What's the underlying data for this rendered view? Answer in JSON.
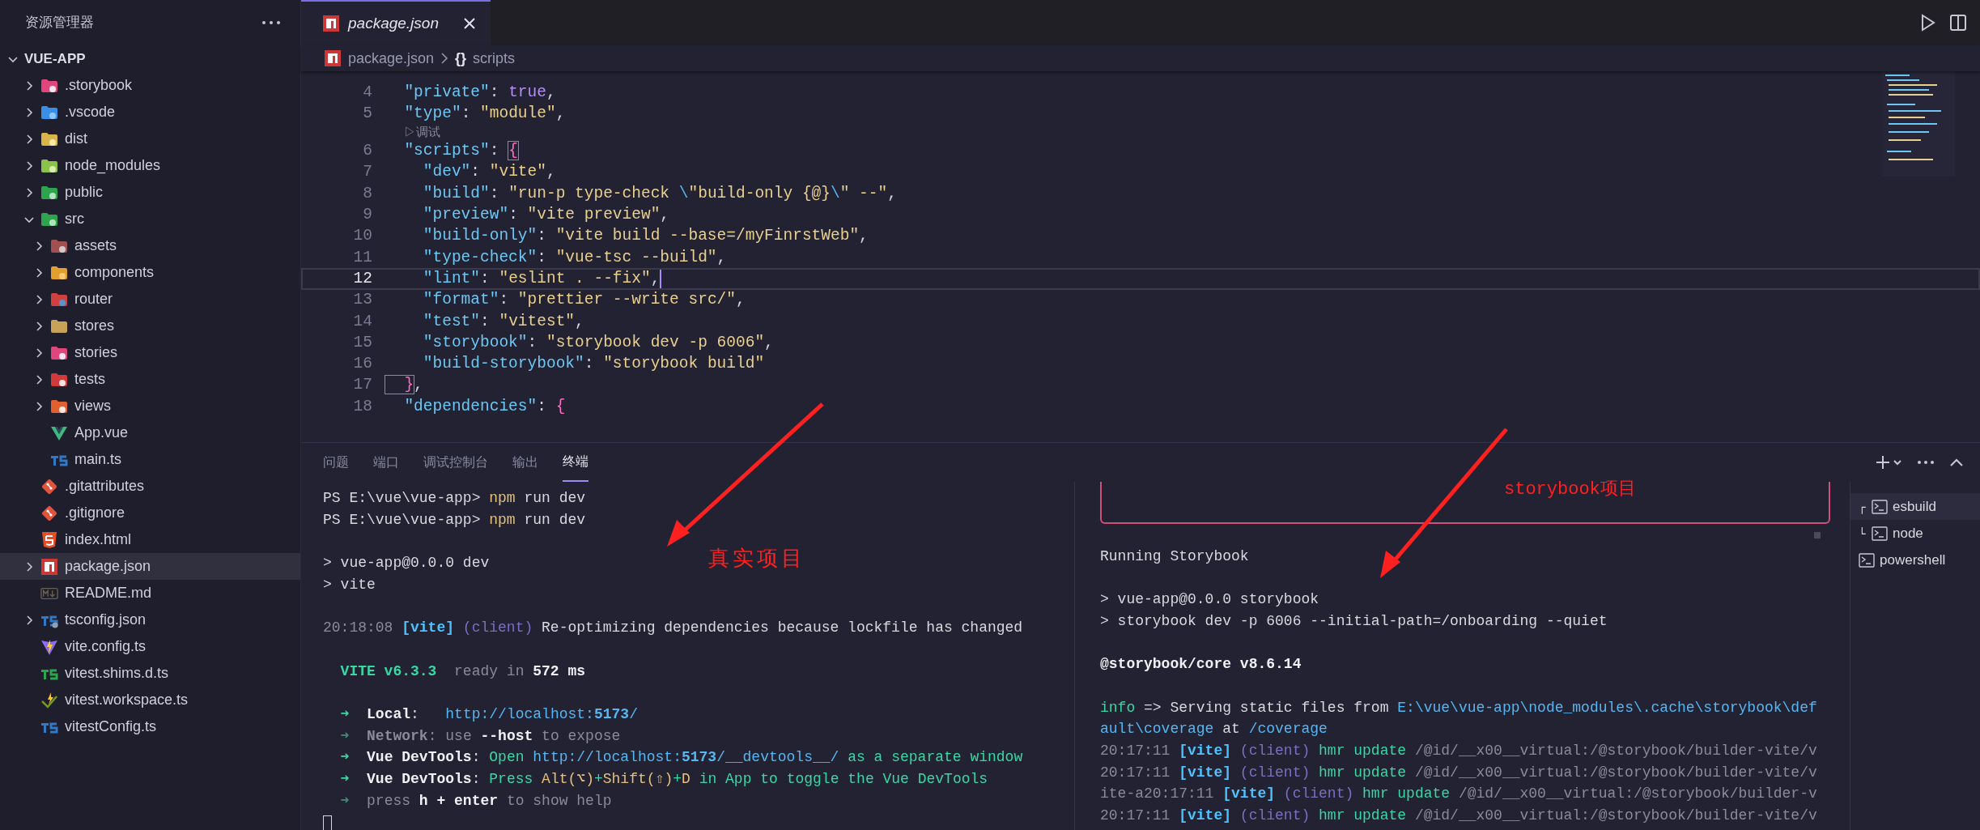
{
  "sidebar": {
    "title": "资源管理器",
    "root": {
      "label": "VUE-APP",
      "expanded": true
    },
    "items": [
      {
        "label": ".storybook",
        "kind": "storybook",
        "expanded": false,
        "selected": false
      },
      {
        "label": ".vscode",
        "kind": "vscode",
        "expanded": false,
        "selected": false
      },
      {
        "label": "dist",
        "kind": "dist",
        "expanded": false,
        "selected": false
      },
      {
        "label": "node_modules",
        "kind": "node",
        "expanded": false,
        "selected": false
      },
      {
        "label": "public",
        "kind": "public",
        "expanded": false,
        "selected": false
      },
      {
        "label": "src",
        "kind": "src",
        "expanded": true,
        "selected": false,
        "children": [
          {
            "label": "assets",
            "kind": "assets",
            "expanded": false,
            "selected": false
          },
          {
            "label": "components",
            "kind": "components",
            "expanded": false,
            "selected": false
          },
          {
            "label": "router",
            "kind": "router",
            "expanded": false,
            "selected": false
          },
          {
            "label": "stores",
            "kind": "stores",
            "expanded": false,
            "selected": false
          },
          {
            "label": "stories",
            "kind": "stories",
            "expanded": false,
            "selected": false
          },
          {
            "label": "tests",
            "kind": "tests",
            "expanded": false,
            "selected": false
          },
          {
            "label": "views",
            "kind": "views",
            "expanded": false,
            "selected": false
          },
          {
            "label": "App.vue",
            "kind": "vue",
            "selected": false
          },
          {
            "label": "main.ts",
            "kind": "ts",
            "selected": false
          }
        ]
      },
      {
        "label": ".gitattributes",
        "kind": "git",
        "selected": false
      },
      {
        "label": ".gitignore",
        "kind": "git",
        "selected": false
      },
      {
        "label": "index.html",
        "kind": "html",
        "selected": false
      },
      {
        "label": "package.json",
        "kind": "npm",
        "expanded": false,
        "selected": true
      },
      {
        "label": "README.md",
        "kind": "md",
        "selected": false
      },
      {
        "label": "tsconfig.json",
        "kind": "tsconfig",
        "expanded": false,
        "selected": false
      },
      {
        "label": "vite.config.ts",
        "kind": "vite",
        "selected": false
      },
      {
        "label": "vitest.shims.d.ts",
        "kind": "tsgreen",
        "selected": false
      },
      {
        "label": "vitest.workspace.ts",
        "kind": "vitest",
        "selected": false
      },
      {
        "label": "vitestConfig.ts",
        "kind": "ts",
        "selected": false
      }
    ]
  },
  "editor": {
    "tabs": [
      {
        "label": "package.json",
        "kind": "npm",
        "preview": true,
        "selected": true
      }
    ],
    "breadcrumb": [
      {
        "label": "package.json",
        "kind": "npm"
      },
      {
        "label": "scripts",
        "symbol": "{}"
      }
    ],
    "lines": [
      {
        "number": "4",
        "current": false,
        "tokens": [
          {
            "text": "  \"private\"",
            "kind": "key"
          },
          {
            "text": ": ",
            "kind": "p"
          },
          {
            "text": "true",
            "kind": "bool"
          },
          {
            "text": ",",
            "kind": "p"
          }
        ]
      },
      {
        "number": "5",
        "current": false,
        "tokens": [
          {
            "text": "  \"type\"",
            "kind": "key"
          },
          {
            "text": ": ",
            "kind": "p"
          },
          {
            "text": "\"module\"",
            "kind": "str"
          },
          {
            "text": ",",
            "kind": "p"
          }
        ]
      },
      {
        "kind": "codelens",
        "text": "▷调试"
      },
      {
        "number": "6",
        "current": false,
        "tokens": [
          {
            "text": "  \"scripts\"",
            "kind": "key"
          },
          {
            "text": ": ",
            "kind": "p"
          },
          {
            "text": "{",
            "kind": "match"
          }
        ]
      },
      {
        "number": "7",
        "current": false,
        "tokens": [
          {
            "text": "    \"dev\"",
            "kind": "key"
          },
          {
            "text": ": ",
            "kind": "p"
          },
          {
            "text": "\"vite\"",
            "kind": "str"
          },
          {
            "text": ",",
            "kind": "p"
          }
        ]
      },
      {
        "number": "8",
        "current": false,
        "tokens": [
          {
            "text": "    \"build\"",
            "kind": "key"
          },
          {
            "text": ": ",
            "kind": "p"
          },
          {
            "text": "\"run-p type-check ",
            "kind": "str"
          },
          {
            "text": "\\",
            "kind": "esc"
          },
          {
            "text": "\"build-only {@}",
            "kind": "str"
          },
          {
            "text": "\\",
            "kind": "esc"
          },
          {
            "text": "\" --\"",
            "kind": "str"
          },
          {
            "text": ",",
            "kind": "p"
          }
        ]
      },
      {
        "number": "9",
        "current": false,
        "tokens": [
          {
            "text": "    \"preview\"",
            "kind": "key"
          },
          {
            "text": ": ",
            "kind": "p"
          },
          {
            "text": "\"vite preview\"",
            "kind": "str"
          },
          {
            "text": ",",
            "kind": "p"
          }
        ]
      },
      {
        "number": "10",
        "current": false,
        "tokens": [
          {
            "text": "    \"build-only\"",
            "kind": "key"
          },
          {
            "text": ": ",
            "kind": "p"
          },
          {
            "text": "\"vite build --base=/myFinrstWeb\"",
            "kind": "str"
          },
          {
            "text": ",",
            "kind": "p"
          }
        ]
      },
      {
        "number": "11",
        "current": false,
        "tokens": [
          {
            "text": "    \"type-check\"",
            "kind": "key"
          },
          {
            "text": ": ",
            "kind": "p"
          },
          {
            "text": "\"vue-tsc --build\"",
            "kind": "str"
          },
          {
            "text": ",",
            "kind": "p"
          }
        ]
      },
      {
        "number": "12",
        "current": true,
        "tokens": [
          {
            "text": "    \"lint\"",
            "kind": "key"
          },
          {
            "text": ": ",
            "kind": "p"
          },
          {
            "text": "\"eslint . --fix\"",
            "kind": "str"
          },
          {
            "text": ",",
            "kind": "p"
          }
        ]
      },
      {
        "number": "13",
        "current": false,
        "tokens": [
          {
            "text": "    \"format\"",
            "kind": "key"
          },
          {
            "text": ": ",
            "kind": "p"
          },
          {
            "text": "\"prettier --write src/\"",
            "kind": "str"
          },
          {
            "text": ",",
            "kind": "p"
          }
        ]
      },
      {
        "number": "14",
        "current": false,
        "tokens": [
          {
            "text": "    \"test\"",
            "kind": "key"
          },
          {
            "text": ": ",
            "kind": "p"
          },
          {
            "text": "\"vitest\"",
            "kind": "str"
          },
          {
            "text": ",",
            "kind": "p"
          }
        ]
      },
      {
        "number": "15",
        "current": false,
        "tokens": [
          {
            "text": "    \"storybook\"",
            "kind": "key"
          },
          {
            "text": ": ",
            "kind": "p"
          },
          {
            "text": "\"storybook dev -p 6006\"",
            "kind": "str"
          },
          {
            "text": ",",
            "kind": "p"
          }
        ]
      },
      {
        "number": "16",
        "current": false,
        "tokens": [
          {
            "text": "    \"build-storybook\"",
            "kind": "key"
          },
          {
            "text": ": ",
            "kind": "p"
          },
          {
            "text": "\"storybook build\"",
            "kind": "str"
          }
        ]
      },
      {
        "number": "17",
        "current": false,
        "tokens": [
          {
            "text": "  }",
            "kind": "match"
          },
          {
            "text": ",",
            "kind": "p"
          }
        ]
      },
      {
        "number": "18",
        "current": false,
        "tokens": [
          {
            "text": "  \"dependencies\"",
            "kind": "key"
          },
          {
            "text": ": ",
            "kind": "p"
          },
          {
            "text": "{",
            "kind": "brace"
          }
        ]
      }
    ]
  },
  "panel": {
    "tabs": [
      {
        "label": "问题",
        "selected": false
      },
      {
        "label": "端口",
        "selected": false
      },
      {
        "label": "调试控制台",
        "selected": false
      },
      {
        "label": "输出",
        "selected": false
      },
      {
        "label": "终端",
        "selected": true
      }
    ],
    "terminals": [
      {
        "lines": [
          {
            "segments": [
              {
                "text": "PS E:\\vue\\vue-app> ",
                "kind": "plain"
              },
              {
                "text": "npm",
                "kind": "cmd"
              },
              {
                "text": " run dev",
                "kind": "plain"
              }
            ]
          },
          {
            "segments": [
              {
                "text": "PS E:\\vue\\vue-app> ",
                "kind": "plain"
              },
              {
                "text": "npm",
                "kind": "cmd"
              },
              {
                "text": " run dev",
                "kind": "plain"
              }
            ]
          },
          {
            "kind": "blank"
          },
          {
            "segments": [
              {
                "text": "> vue-app@0.0.0 dev",
                "kind": "plain"
              }
            ]
          },
          {
            "segments": [
              {
                "text": "> vite",
                "kind": "plain"
              }
            ]
          },
          {
            "kind": "blank"
          },
          {
            "segments": [
              {
                "text": "20:18:08 ",
                "kind": "dim"
              },
              {
                "text": "[vite]",
                "kind": "tag"
              },
              {
                "text": " (client)",
                "kind": "client"
              },
              {
                "text": " Re-optimizing dependencies because lockfile has changed",
                "kind": "plain"
              }
            ]
          },
          {
            "kind": "blank"
          },
          {
            "segments": [
              {
                "text": "  VITE v6.3.3",
                "kind": "greenbold"
              },
              {
                "text": "  ready in ",
                "kind": "dim"
              },
              {
                "text": "572 ms",
                "kind": "strong"
              }
            ]
          },
          {
            "kind": "blank"
          },
          {
            "segments": [
              {
                "text": "  ➜  ",
                "kind": "greenbold"
              },
              {
                "text": "Local",
                "kind": "strong"
              },
              {
                "text": ":   ",
                "kind": "plain"
              },
              {
                "text": "http://localhost:",
                "kind": "link"
              },
              {
                "text": "5173",
                "kind": "linkbold"
              },
              {
                "text": "/",
                "kind": "link"
              }
            ]
          },
          {
            "segments": [
              {
                "text": "  ➜  ",
                "kind": "arrowdim"
              },
              {
                "text": "Network",
                "kind": "dimbold"
              },
              {
                "text": ": use ",
                "kind": "dim"
              },
              {
                "text": "--host",
                "kind": "strong"
              },
              {
                "text": " to expose",
                "kind": "dim"
              }
            ]
          },
          {
            "segments": [
              {
                "text": "  ➜  ",
                "kind": "greenbold"
              },
              {
                "text": "Vue DevTools",
                "kind": "strong"
              },
              {
                "text": ": ",
                "kind": "plain"
              },
              {
                "text": "Open ",
                "kind": "green"
              },
              {
                "text": "http://localhost:",
                "kind": "link"
              },
              {
                "text": "5173",
                "kind": "linkbold"
              },
              {
                "text": "/__devtools__/",
                "kind": "link"
              },
              {
                "text": " as a separate window",
                "kind": "green"
              }
            ]
          },
          {
            "segments": [
              {
                "text": "  ➜  ",
                "kind": "greenbold"
              },
              {
                "text": "Vue DevTools",
                "kind": "strong"
              },
              {
                "text": ": ",
                "kind": "plain"
              },
              {
                "text": "Press ",
                "kind": "green"
              },
              {
                "text": "Alt(⌥)",
                "kind": "yellow"
              },
              {
                "text": "+",
                "kind": "green"
              },
              {
                "text": "Shift(⇧)",
                "kind": "yellow"
              },
              {
                "text": "+",
                "kind": "green"
              },
              {
                "text": "D",
                "kind": "yellow"
              },
              {
                "text": " in App to toggle the Vue DevTools",
                "kind": "green"
              }
            ]
          },
          {
            "segments": [
              {
                "text": "  ➜  ",
                "kind": "arrowdim"
              },
              {
                "text": "press ",
                "kind": "dim"
              },
              {
                "text": "h + enter",
                "kind": "strong"
              },
              {
                "text": " to show help",
                "kind": "dim"
              }
            ]
          },
          {
            "kind": "cursor"
          }
        ]
      },
      {
        "lines": [
          {
            "kind": "frame"
          },
          {
            "kind": "blank"
          },
          {
            "segments": [
              {
                "text": "Running Storybook",
                "kind": "plain"
              }
            ]
          },
          {
            "kind": "blank"
          },
          {
            "segments": [
              {
                "text": "> vue-app@0.0.0 storybook",
                "kind": "plain"
              }
            ]
          },
          {
            "segments": [
              {
                "text": "> storybook dev -p 6006 --initial-path=/onboarding --quiet",
                "kind": "plain"
              }
            ]
          },
          {
            "kind": "blank"
          },
          {
            "segments": [
              {
                "text": "@storybook/core v8.6.14",
                "kind": "strong"
              }
            ]
          },
          {
            "kind": "blank"
          },
          {
            "segments": [
              {
                "text": "info",
                "kind": "green"
              },
              {
                "text": " => Serving static files from ",
                "kind": "plain"
              },
              {
                "text": "E:\\vue\\vue-app\\node_modules\\.cache\\storybook\\def",
                "kind": "link"
              }
            ]
          },
          {
            "segments": [
              {
                "text": "ault\\coverage",
                "kind": "link"
              },
              {
                "text": " at ",
                "kind": "plain"
              },
              {
                "text": "/coverage",
                "kind": "link"
              }
            ]
          },
          {
            "segments": [
              {
                "text": "20:17:11 ",
                "kind": "dim"
              },
              {
                "text": "[vite]",
                "kind": "tag"
              },
              {
                "text": " (client)",
                "kind": "client"
              },
              {
                "text": " hmr update",
                "kind": "green"
              },
              {
                "text": " /@id/__x00__virtual:/@storybook/builder-vite/v",
                "kind": "dim"
              }
            ]
          },
          {
            "segments": [
              {
                "text": "20:17:11 ",
                "kind": "dim"
              },
              {
                "text": "[vite]",
                "kind": "tag"
              },
              {
                "text": " (client)",
                "kind": "client"
              },
              {
                "text": " hmr update",
                "kind": "green"
              },
              {
                "text": " /@id/__x00__virtual:/@storybook/builder-vite/v",
                "kind": "dim"
              }
            ]
          },
          {
            "segments": [
              {
                "text": "ite-a20:17:11 ",
                "kind": "dim"
              },
              {
                "text": "[vite]",
                "kind": "tag"
              },
              {
                "text": " (client)",
                "kind": "client"
              },
              {
                "text": " hmr update",
                "kind": "green"
              },
              {
                "text": " /@id/__x00__virtual:/@storybook/builder-v",
                "kind": "dim"
              }
            ]
          },
          {
            "segments": [
              {
                "text": "20:17:11 ",
                "kind": "dim"
              },
              {
                "text": "[vite]",
                "kind": "tag"
              },
              {
                "text": " (client)",
                "kind": "client"
              },
              {
                "text": " hmr update",
                "kind": "green"
              },
              {
                "text": " /@id/__x00__virtual:/@storybook/builder-vite/v",
                "kind": "dim"
              }
            ]
          }
        ]
      }
    ],
    "terminal_list": [
      {
        "prefix": "┌",
        "label": "esbuild",
        "selected": true
      },
      {
        "prefix": "└",
        "label": "node",
        "selected": false
      },
      {
        "label": "powershell",
        "selected": false
      }
    ]
  },
  "annotations": [
    {
      "text": "真实项目"
    },
    {
      "text": "storybook项目"
    }
  ]
}
